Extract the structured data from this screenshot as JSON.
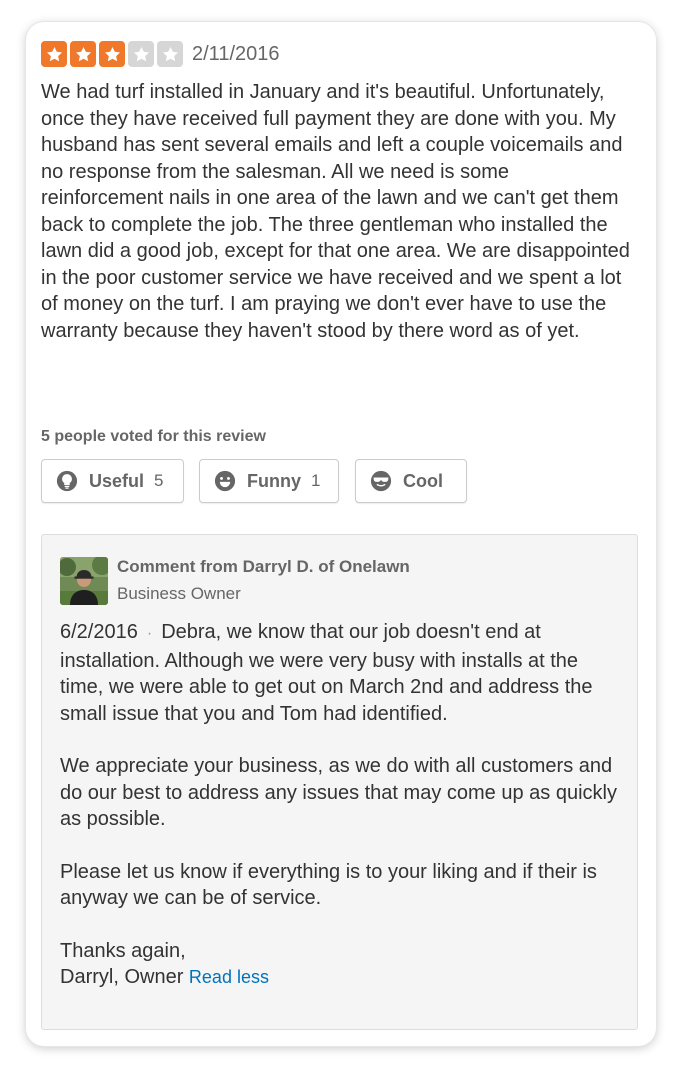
{
  "review": {
    "rating": 3,
    "max_rating": 5,
    "star_color": "#f0782a",
    "star_off_color": "#d6d6d6",
    "date": "2/11/2016",
    "text": "We had turf installed in January and it's beautiful. Unfortunately, once they have received full payment they are done with you. My husband has sent several emails and left a couple voicemails and no response from the salesman. All we need is some reinforcement nails in one area of the lawn and we can't get them back to complete the job. The three gentleman who installed the lawn did a good job, except for that one area. We are disappointed in the poor customer service we have received and we spent a lot of money on the turf. I am praying we don't ever have to use the warranty because they haven't stood by there word as of yet."
  },
  "votes": {
    "label": "5 people voted for this review",
    "useful": {
      "label": "Useful",
      "count": "5",
      "icon": "lightbulb-icon"
    },
    "funny": {
      "label": "Funny",
      "count": "1",
      "icon": "smiley-face-icon"
    },
    "cool": {
      "label": "Cool",
      "count": "",
      "icon": "sunglasses-face-icon"
    }
  },
  "comment": {
    "author": "Comment from Darryl D. of Onelawn",
    "role": "Business Owner",
    "date": "6/2/2016",
    "separator": "·",
    "paragraphs": [
      "Debra, we know that our job doesn't end at installation.  Although we were very busy with installs at the time, we were able to get out on March 2nd and address the small issue that you and Tom had identified.",
      "We appreciate your business, as we do with all customers and do our best to address any  issues that may come up as quickly as possible.",
      "Please let us know if everything is to your liking and if their is anyway we can be of service.",
      "Thanks again,",
      "Darryl, Owner"
    ],
    "read_less": "Read less",
    "link_color": "#0073bb"
  }
}
